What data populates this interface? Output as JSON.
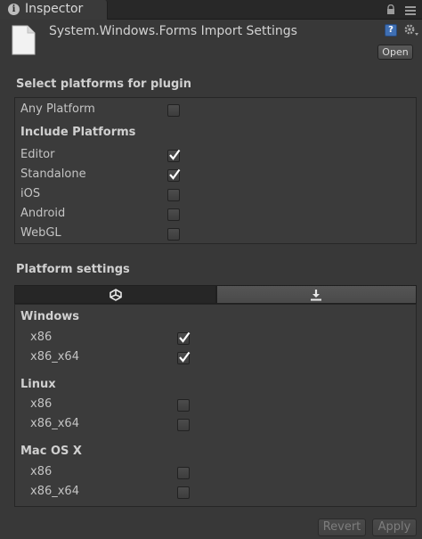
{
  "window": {
    "tab_label": "Inspector"
  },
  "header": {
    "title": "System.Windows.Forms Import Settings",
    "open_label": "Open",
    "help_glyph": "?"
  },
  "select_platforms": {
    "title": "Select platforms for plugin",
    "any_platform": {
      "label": "Any Platform",
      "checked": false
    },
    "include_title": "Include Platforms",
    "platforms": [
      {
        "label": "Editor",
        "checked": true
      },
      {
        "label": "Standalone",
        "checked": true
      },
      {
        "label": "iOS",
        "checked": false
      },
      {
        "label": "Android",
        "checked": false
      },
      {
        "label": "WebGL",
        "checked": false
      }
    ]
  },
  "platform_settings": {
    "title": "Platform settings",
    "tabs": [
      {
        "icon": "unity-logo-icon",
        "active": true
      },
      {
        "icon": "download-icon",
        "active": false
      }
    ],
    "groups": [
      {
        "name": "Windows",
        "items": [
          {
            "label": "x86",
            "checked": true
          },
          {
            "label": "x86_x64",
            "checked": true
          }
        ]
      },
      {
        "name": "Linux",
        "items": [
          {
            "label": "x86",
            "checked": false
          },
          {
            "label": "x86_x64",
            "checked": false
          }
        ]
      },
      {
        "name": "Mac OS X",
        "items": [
          {
            "label": "x86",
            "checked": false
          },
          {
            "label": "x86_x64",
            "checked": false
          }
        ]
      }
    ]
  },
  "footer": {
    "revert_label": "Revert",
    "apply_label": "Apply"
  }
}
